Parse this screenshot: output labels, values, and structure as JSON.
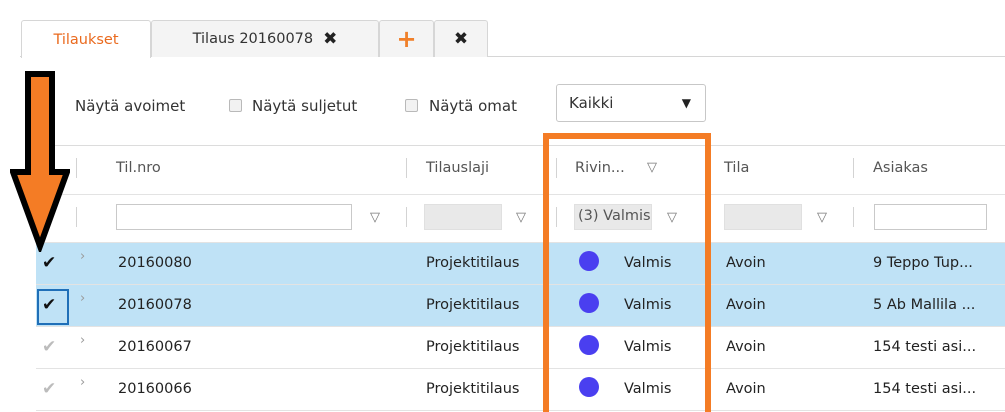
{
  "tabs": [
    {
      "label": "Tilaukset"
    },
    {
      "label": "Tilaus 20160078",
      "close": "✖"
    },
    {
      "label": "+"
    },
    {
      "label": "✖"
    }
  ],
  "filters": {
    "show_open": "Näytä avoimet",
    "show_closed": "Näytä suljetut",
    "show_own": "Näytä omat",
    "scope_select": "Kaikki",
    "arrow": "▼"
  },
  "columns": {
    "order_no": "Til.nro",
    "order_type": "Tilauslaji",
    "row_status": "Rivin...",
    "status": "Tila",
    "customer": "Asiakas"
  },
  "column_filters": {
    "row_status_value": "(3) Valmis"
  },
  "rows": [
    {
      "checked": true,
      "order_no": "20160080",
      "order_type": "Projektitilaus",
      "row_status": "Valmis",
      "status": "Avoin",
      "customer": "9 Teppo Tup..."
    },
    {
      "checked": true,
      "order_no": "20160078",
      "order_type": "Projektitilaus",
      "row_status": "Valmis",
      "status": "Avoin",
      "customer": "5 Ab Mallila ..."
    },
    {
      "checked": false,
      "order_no": "20160067",
      "order_type": "Projektitilaus",
      "row_status": "Valmis",
      "status": "Avoin",
      "customer": "154 testi asi..."
    },
    {
      "checked": false,
      "order_no": "20160066",
      "order_type": "Projektitilaus",
      "row_status": "Valmis",
      "status": "Avoin",
      "customer": "154 testi asi..."
    }
  ],
  "colors": {
    "accent": "#ea6a1e",
    "annotation": "#f47c25",
    "selected_row": "#bfe2f6",
    "status_dot": "#4a3ff0"
  },
  "icons": {
    "check": "✔",
    "chevron": "›",
    "funnel": "▽"
  }
}
